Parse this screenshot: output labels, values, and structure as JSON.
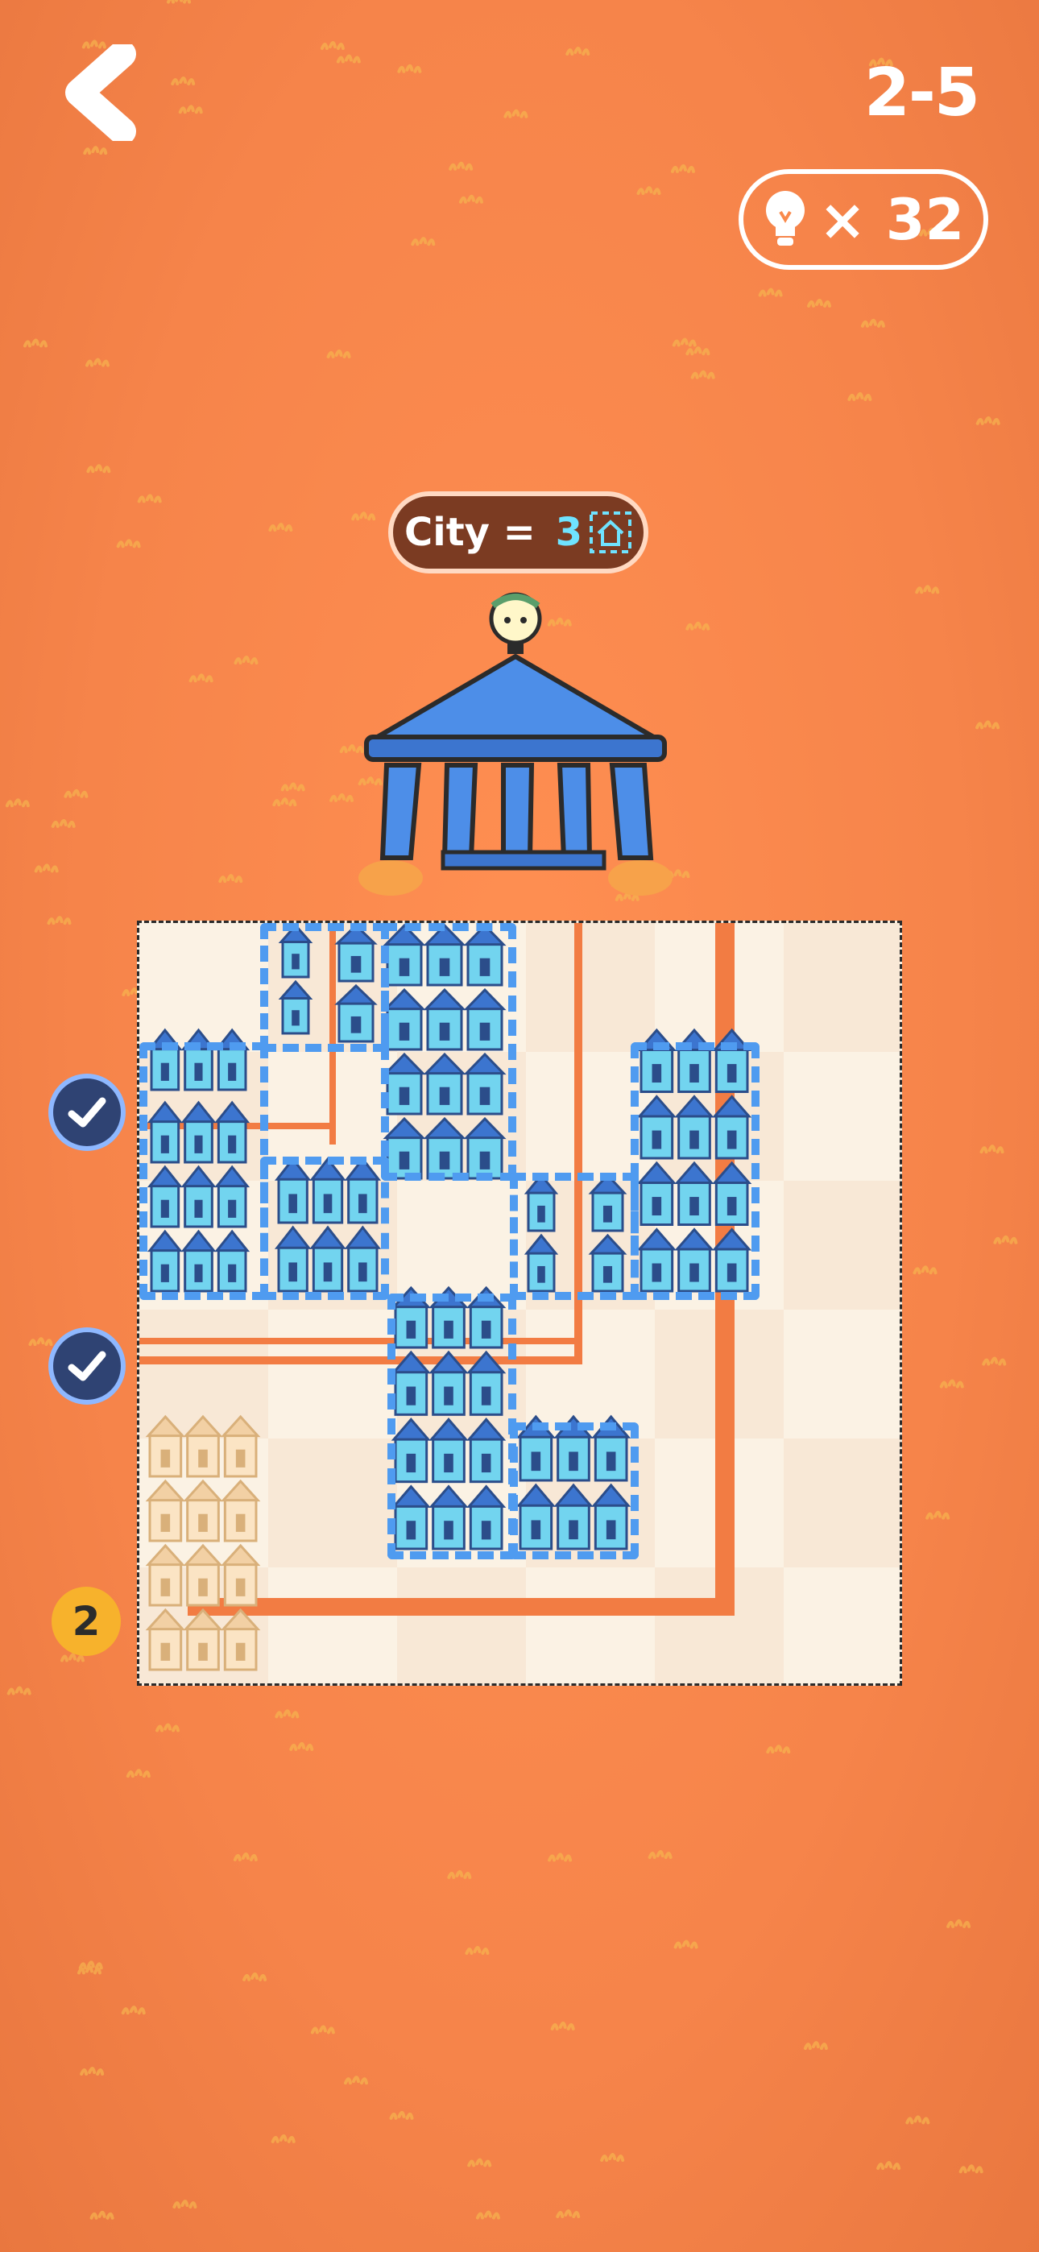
{
  "header": {
    "level_label": "2-5",
    "hint_count_label": "× 32"
  },
  "objective": {
    "prefix": "City = ",
    "value": "3"
  },
  "row_status": {
    "row_2_value": "2"
  },
  "icons": {
    "back": "chevron-left-icon",
    "hint": "lightbulb-icon",
    "house": "house-icon",
    "check": "check-icon"
  },
  "colors": {
    "background": "#f98a4c",
    "board": "#fbf0e1",
    "city_blue": "#6fe3ff",
    "region_dash": "#4f9bf0",
    "road": "#f27c43",
    "badge_yellow": "#f7b22c",
    "check_bg": "#2f4373"
  }
}
